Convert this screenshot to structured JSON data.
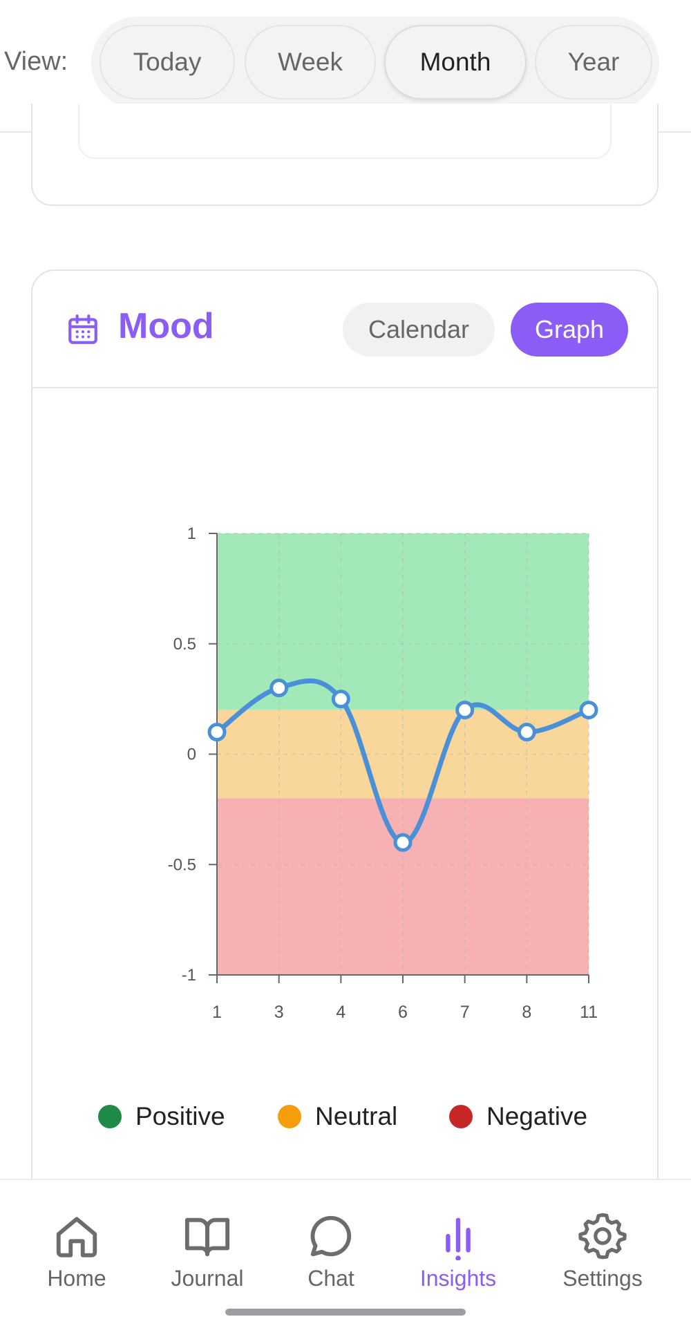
{
  "view": {
    "label": "View:",
    "options": [
      "Today",
      "Week",
      "Month",
      "Year"
    ],
    "selected": "Month"
  },
  "mood": {
    "title": "Mood",
    "toggles": {
      "calendar": "Calendar",
      "graph": "Graph"
    },
    "active_toggle": "Graph"
  },
  "chart_data": {
    "type": "line",
    "x": [
      1,
      3,
      4,
      6,
      7,
      8,
      11
    ],
    "y": [
      0.1,
      0.3,
      0.25,
      -0.4,
      0.2,
      0.1,
      0.2
    ],
    "x_tick_labels": [
      "1",
      "3",
      "4",
      "6",
      "7",
      "8",
      "11"
    ],
    "y_tick_labels": [
      "1",
      "0.5",
      "0",
      "-0.5",
      "-1"
    ],
    "ylim": [
      -1,
      1
    ],
    "grid": true,
    "bands": [
      {
        "name": "Positive",
        "from": 0.2,
        "to": 1,
        "color": "#a3e8b8"
      },
      {
        "name": "Neutral",
        "from": -0.2,
        "to": 0.2,
        "color": "#f9d79a"
      },
      {
        "name": "Negative",
        "from": -1,
        "to": -0.2,
        "color": "#f7b1b3"
      }
    ],
    "line_color": "#4a90d9",
    "legend": [
      {
        "label": "Positive",
        "color": "#1e8a45"
      },
      {
        "label": "Neutral",
        "color": "#f59e0b"
      },
      {
        "label": "Negative",
        "color": "#c62828"
      }
    ],
    "legend_position": "bottom"
  },
  "nav": {
    "items": [
      {
        "label": "Home",
        "icon": "home-icon"
      },
      {
        "label": "Journal",
        "icon": "book-icon"
      },
      {
        "label": "Chat",
        "icon": "chat-icon"
      },
      {
        "label": "Insights",
        "icon": "insights-icon"
      },
      {
        "label": "Settings",
        "icon": "gear-icon"
      }
    ],
    "active": "Insights"
  },
  "colors": {
    "accent": "#8b5cf6"
  }
}
